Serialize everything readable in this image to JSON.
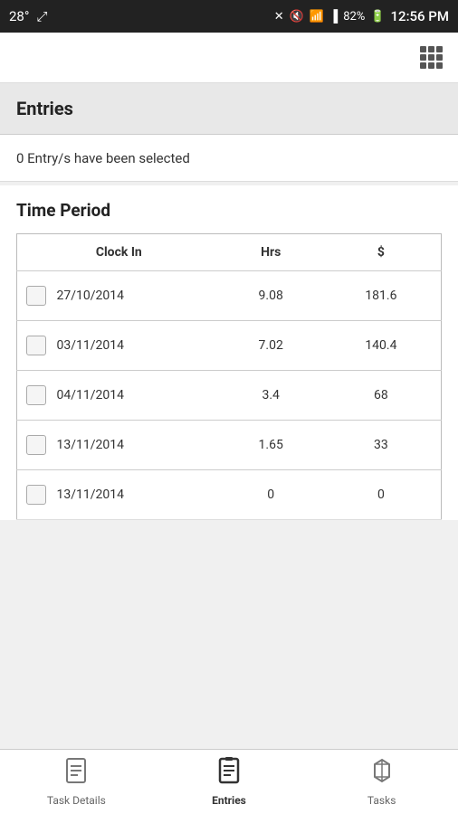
{
  "statusBar": {
    "temperature": "28°",
    "time": "12:56 PM",
    "battery": "82%"
  },
  "appBar": {
    "gridIcon": "grid-icon"
  },
  "entriesHeader": {
    "title": "Entries"
  },
  "selectionBanner": {
    "text": "0 Entry/s have been selected"
  },
  "timePeriod": {
    "title": "Time Period",
    "tableHeaders": {
      "clockIn": "Clock In",
      "hrs": "Hrs",
      "dollar": "$"
    },
    "rows": [
      {
        "date": "27/10/2014",
        "hrs": "9.08",
        "amount": "181.6"
      },
      {
        "date": "03/11/2014",
        "hrs": "7.02",
        "amount": "140.4"
      },
      {
        "date": "04/11/2014",
        "hrs": "3.4",
        "amount": "68"
      },
      {
        "date": "13/11/2014",
        "hrs": "1.65",
        "amount": "33"
      },
      {
        "date": "13/11/2014",
        "hrs": "0",
        "amount": "0"
      }
    ]
  },
  "bottomNav": {
    "items": [
      {
        "id": "task-details",
        "label": "Task Details",
        "active": false
      },
      {
        "id": "entries",
        "label": "Entries",
        "active": true
      },
      {
        "id": "tasks",
        "label": "Tasks",
        "active": false
      }
    ]
  }
}
